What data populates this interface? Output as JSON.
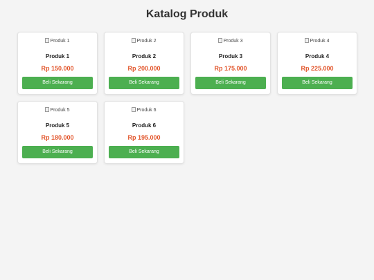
{
  "page": {
    "title": "Katalog Produk"
  },
  "products": [
    {
      "image_alt": "Produk 1",
      "name": "Produk 1",
      "price": "Rp 150.000",
      "button": "Beli Sekarang"
    },
    {
      "image_alt": "Produk 2",
      "name": "Produk 2",
      "price": "Rp 200.000",
      "button": "Beli Sekarang"
    },
    {
      "image_alt": "Produk 3",
      "name": "Produk 3",
      "price": "Rp 175.000",
      "button": "Beli Sekarang"
    },
    {
      "image_alt": "Produk 4",
      "name": "Produk 4",
      "price": "Rp 225.000",
      "button": "Beli Sekarang"
    },
    {
      "image_alt": "Produk 5",
      "name": "Produk 5",
      "price": "Rp 180.000",
      "button": "Beli Sekarang"
    },
    {
      "image_alt": "Produk 6",
      "name": "Produk 6",
      "price": "Rp 195.000",
      "button": "Beli Sekarang"
    }
  ],
  "colors": {
    "accent_button": "#4caf50",
    "price": "#e2552b",
    "background": "#f4f4f4"
  },
  "icons": {
    "image_placeholder": "broken-image-icon"
  }
}
